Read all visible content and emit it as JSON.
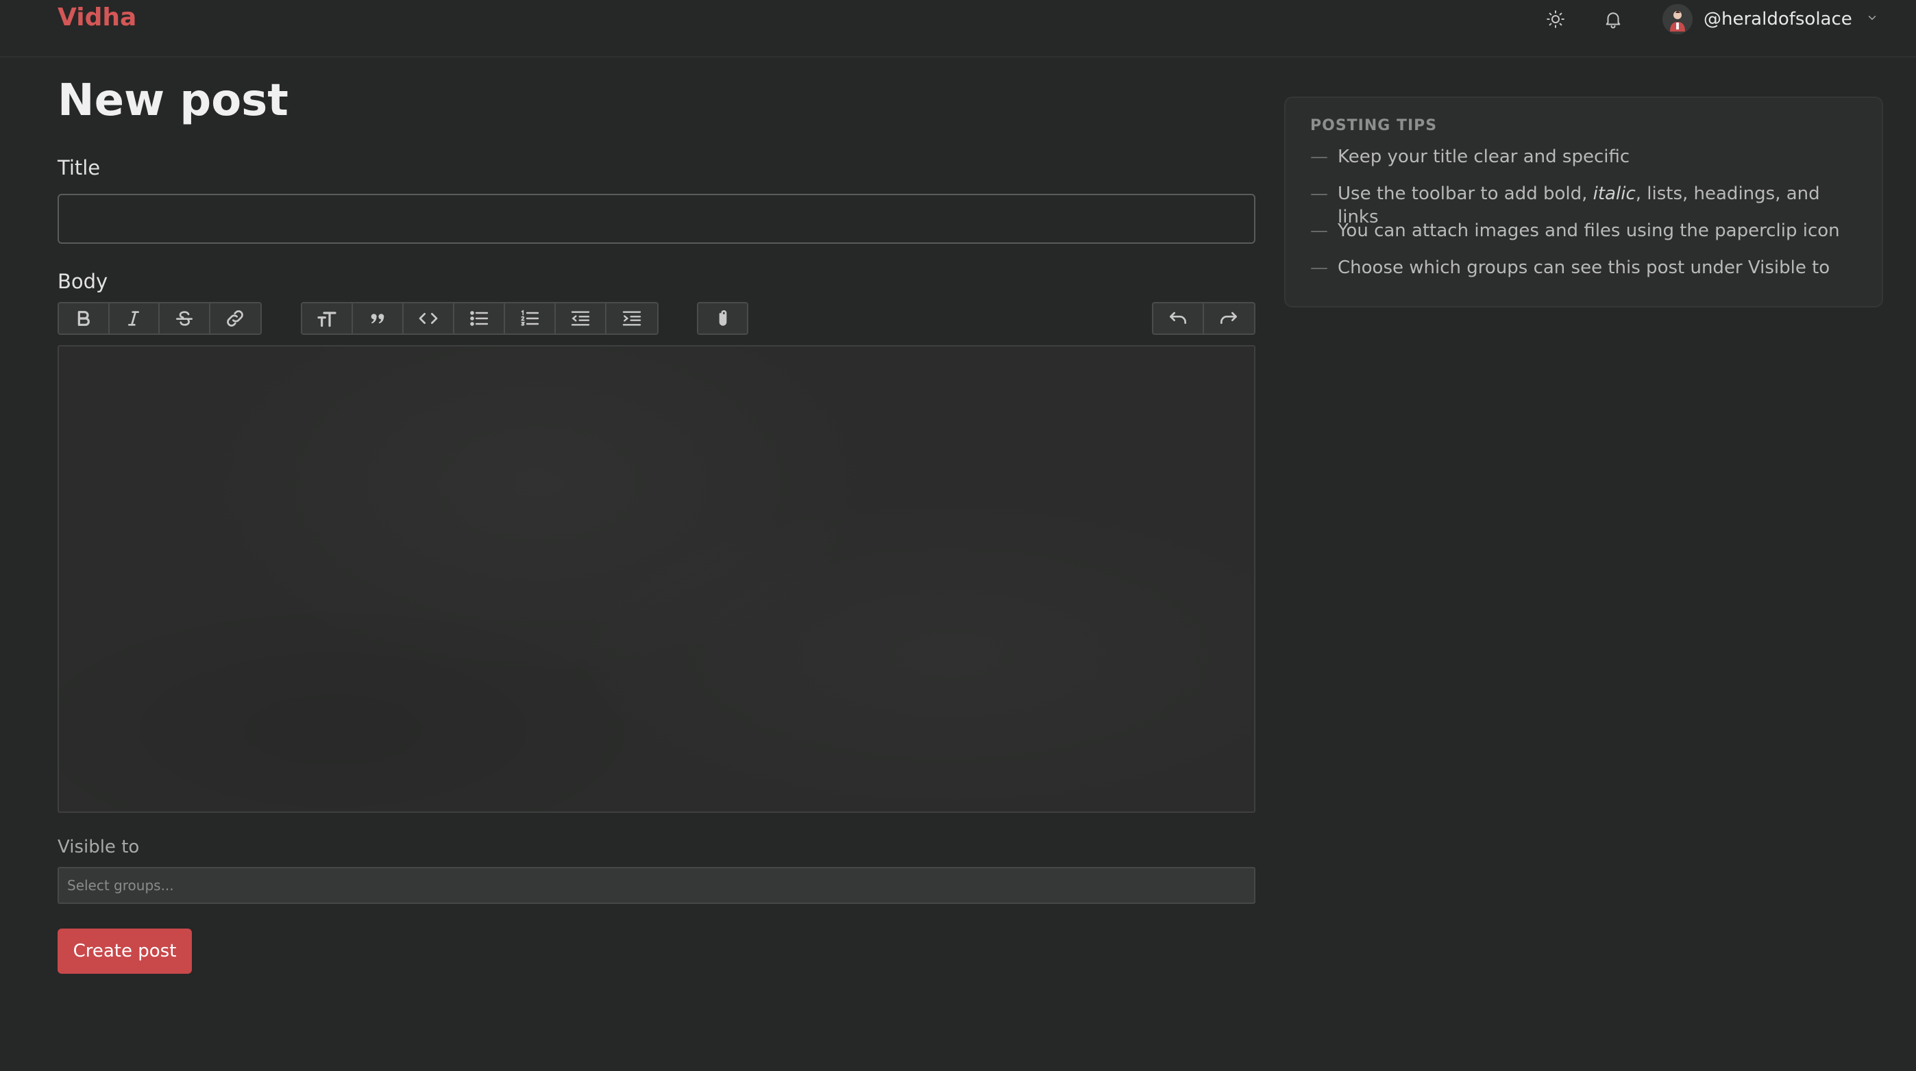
{
  "brand": "Vidha",
  "header": {
    "theme_icon": "sun-icon",
    "notifications_icon": "bell-icon",
    "username": "@heraldofsolace"
  },
  "page_title": "New post",
  "form": {
    "title_label": "Title",
    "title_value": "",
    "body_label": "Body",
    "toolbar": {
      "text_group": [
        "bold-icon",
        "italic-icon",
        "strikethrough-icon",
        "link-icon"
      ],
      "block_group": [
        "heading-icon",
        "quote-icon",
        "code-icon",
        "bullet-list-icon",
        "numbered-list-icon",
        "outdent-icon",
        "indent-icon"
      ],
      "attach_group": [
        "paperclip-icon"
      ],
      "history_group": [
        "undo-icon",
        "redo-icon"
      ]
    },
    "body_value": "",
    "visible_label": "Visible to",
    "groups_placeholder": "Select groups...",
    "submit_label": "Create post"
  },
  "tips": {
    "heading": "POSTING TIPS",
    "items": [
      {
        "dash": "—",
        "text": "Keep your title clear and specific"
      },
      {
        "dash": "—",
        "before": "Use the toolbar to add bold, ",
        "italic": "italic",
        "after": ", lists, headings, and links"
      },
      {
        "dash": "—",
        "text": "You can attach images and files using the paperclip icon"
      },
      {
        "dash": "—",
        "text": "Choose which groups can see this post under Visible to"
      }
    ]
  },
  "colors": {
    "background": "#262727",
    "brand": "#d45757",
    "primary_button": "#c9484a"
  }
}
